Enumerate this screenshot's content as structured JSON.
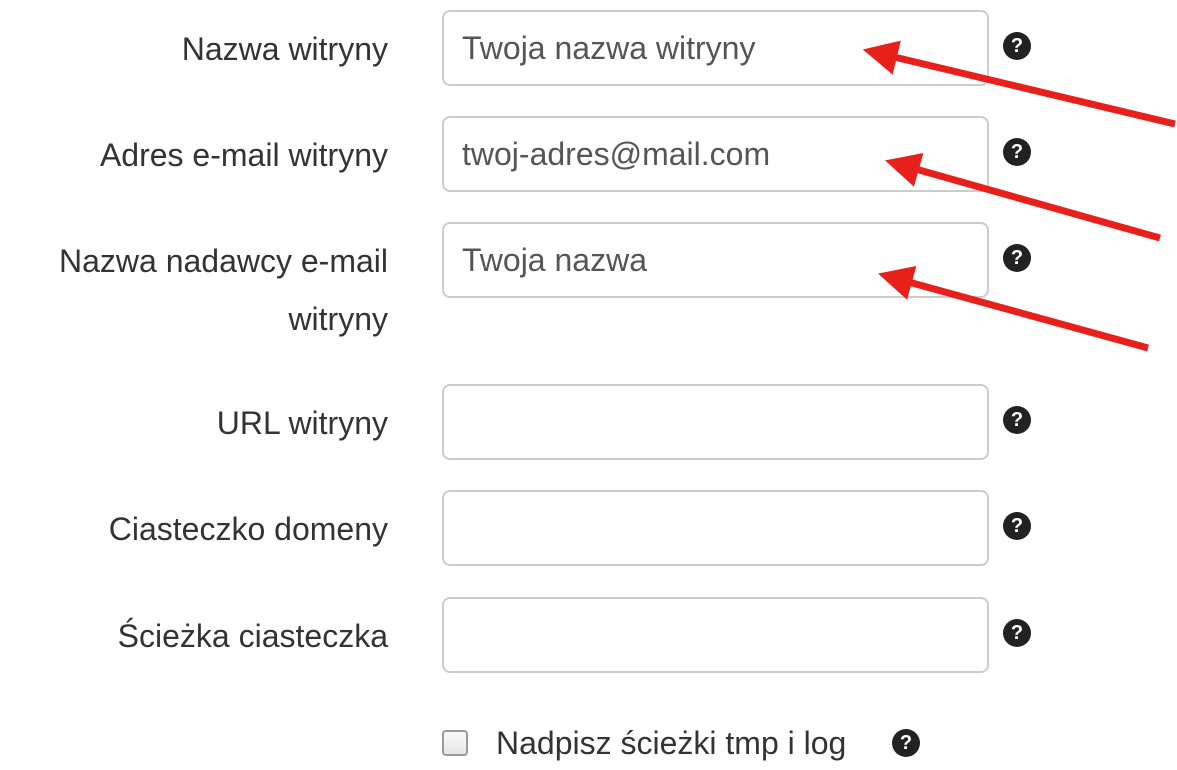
{
  "fields": [
    {
      "label": "Nazwa witryny",
      "value": "Twoja nazwa witryny",
      "placeholder": ""
    },
    {
      "label": "Adres e-mail witryny",
      "value": "twoj-adres@mail.com",
      "placeholder": ""
    },
    {
      "label_line1": "Nazwa nadawcy e-mail",
      "label_line2": "witryny",
      "value": "Twoja nazwa",
      "placeholder": ""
    },
    {
      "label": "URL witryny",
      "value": "",
      "placeholder": ""
    },
    {
      "label": "Ciasteczko domeny",
      "value": "",
      "placeholder": ""
    },
    {
      "label": "Ścieżka ciasteczka",
      "value": "",
      "placeholder": ""
    }
  ],
  "checkbox": {
    "label": "Nadpisz ścieżki tmp i log",
    "checked": false
  },
  "icons": {
    "help": "question-circle-icon",
    "annotation": "red-arrow-icon"
  },
  "colors": {
    "annotation_arrow": "#e8201c",
    "help_icon": "#222222",
    "input_border": "#cccccc"
  },
  "help_glyph": "?"
}
